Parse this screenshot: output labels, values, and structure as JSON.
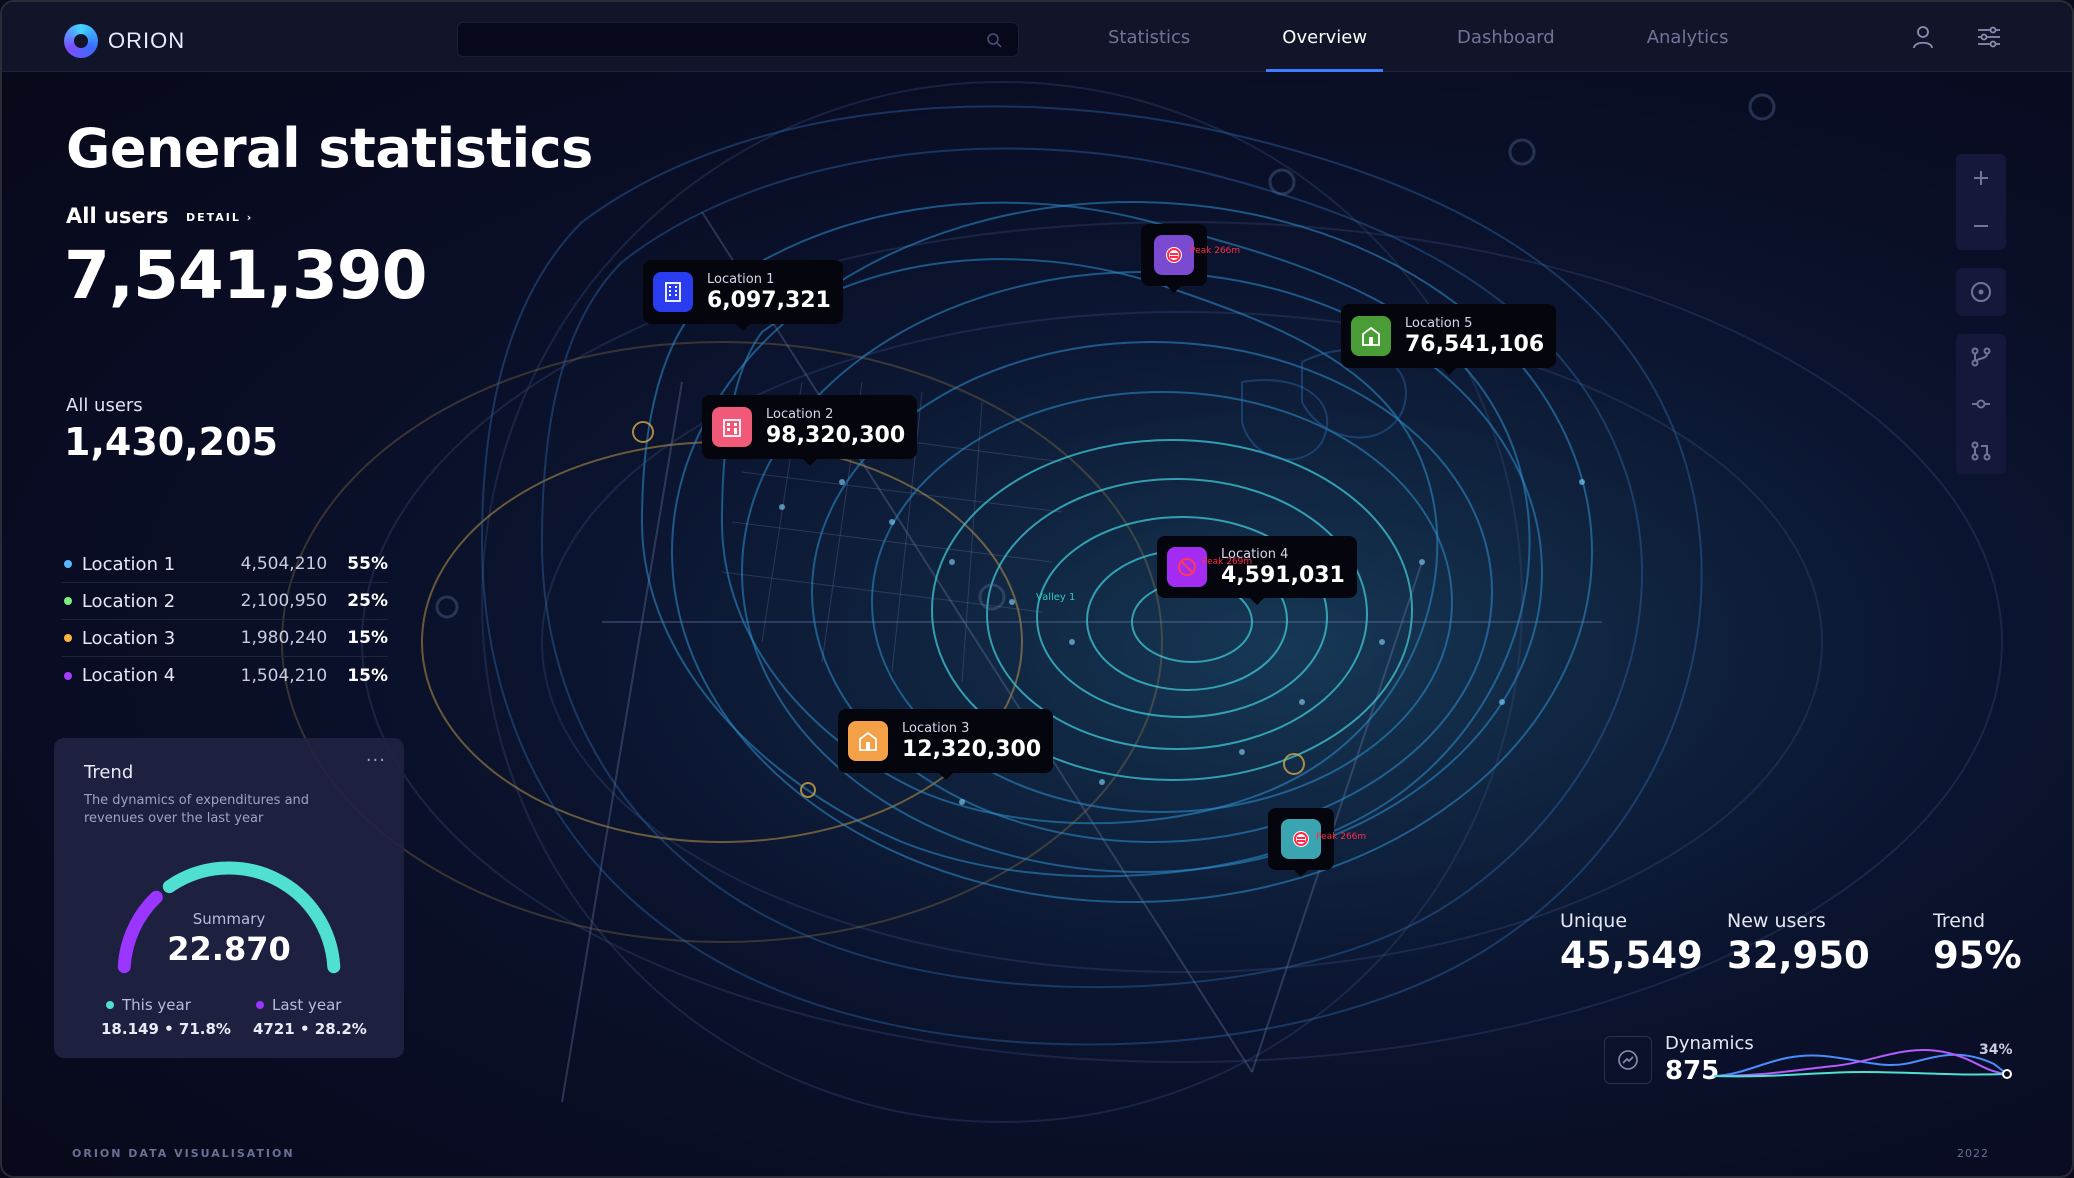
{
  "app": {
    "name": "ORION"
  },
  "search": {
    "placeholder": ""
  },
  "nav": {
    "items": [
      {
        "label": "Statistics"
      },
      {
        "label": "Overview"
      },
      {
        "label": "Dashboard"
      },
      {
        "label": "Analytics"
      }
    ],
    "active": "Overview"
  },
  "header": {
    "title": "General statistics",
    "all_users_label": "All users",
    "detail_link": "DETAIL ›",
    "all_users_value": "7,541,390"
  },
  "secondary": {
    "label": "All users",
    "value": "1,430,205"
  },
  "locations": [
    {
      "name": "Location 1",
      "value": "4,504,210",
      "percent": "55%",
      "color": "#5ab6ff"
    },
    {
      "name": "Location 2",
      "value": "2,100,950",
      "percent": "25%",
      "color": "#7cf07e"
    },
    {
      "name": "Location 3",
      "value": "1,980,240",
      "percent": "15%",
      "color": "#ffb43d"
    },
    {
      "name": "Location 4",
      "value": "1,504,210",
      "percent": "15%",
      "color": "#a23cff"
    }
  ],
  "trend_card": {
    "title": "Trend",
    "more": "···",
    "description": "The dynamics of expenditures and revenues over the last year",
    "summary_label": "Summary",
    "summary_value": "22.870",
    "this_year_label": "This year",
    "this_year_value": "18.149 • 71.8%",
    "this_year_fraction": 0.718,
    "last_year_label": "Last year",
    "last_year_value": "4721 • 28.2%",
    "last_year_fraction": 0.282,
    "colors": {
      "this_year": "#4fe0d2",
      "last_year": "#9a36ff"
    }
  },
  "map_pins": [
    {
      "label": "Location 1",
      "value": "6,097,321",
      "icon": "building-icon",
      "color": "#2a3cf0"
    },
    {
      "label": "Location 2",
      "value": "98,320,300",
      "icon": "office-icon",
      "color": "#f05a78"
    },
    {
      "label": "Location 3",
      "value": "12,320,300",
      "icon": "warehouse-icon",
      "color": "#f4a046"
    },
    {
      "label": "Location 4",
      "value": "4,591,031",
      "icon": "blocked-icon",
      "color": "#a22cf2"
    },
    {
      "label": "Location 5",
      "value": "76,541,106",
      "icon": "warehouse-icon",
      "color": "#4a9c36"
    }
  ],
  "map_markers": [
    {
      "name": "peak-marker-1",
      "label": "Peak 266m",
      "color": "#7a4ad0"
    },
    {
      "name": "peak-marker-2",
      "label": "Peak 266m",
      "color": "#3aa4b0"
    }
  ],
  "map_labels": {
    "valley": "Valley 1",
    "peak_loc4": "Peak 269m"
  },
  "map_tools": [
    "zoom-in-icon",
    "zoom-out-icon",
    "locate-icon",
    "branch-icon",
    "commit-icon",
    "pull-request-icon"
  ],
  "stats": [
    {
      "label": "Unique",
      "value": "45,549"
    },
    {
      "label": "New users",
      "value": "32,950"
    },
    {
      "label": "Trend",
      "value": "95%"
    }
  ],
  "dynamics": {
    "label": "Dynamics",
    "value": "875",
    "percent": "34%"
  },
  "footer": {
    "left": "ORION DATA VISUALISATION",
    "right": "2022"
  }
}
